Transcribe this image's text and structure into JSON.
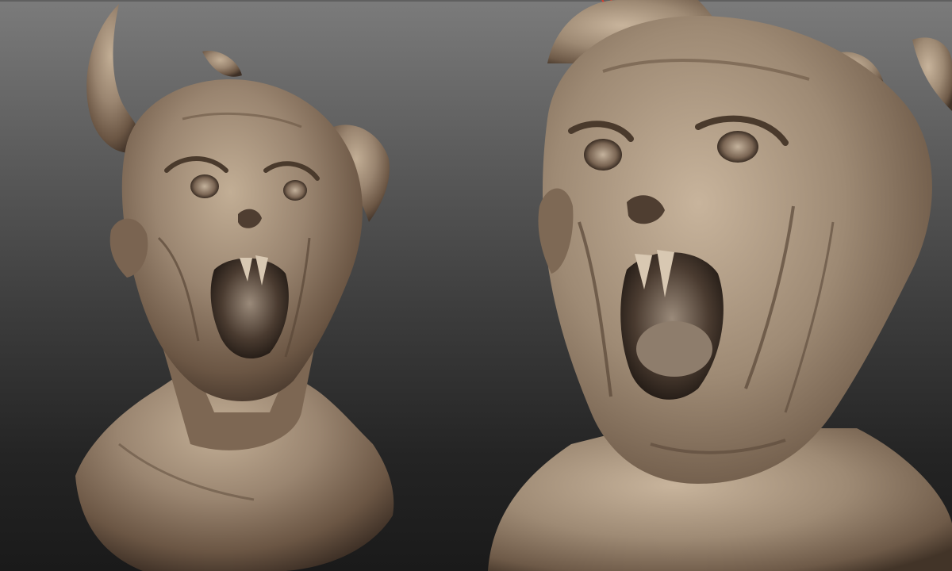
{
  "viewport": {
    "background_top": "#7b7b7b",
    "background_bottom": "#1a1a1a",
    "clay_color": "#8f7a64",
    "clay_light": "#b8a48c",
    "clay_dark": "#4a3a2c",
    "marker_color": "#d93a2a"
  },
  "models": [
    {
      "name": "creature-bust-three-quarter-view",
      "icon": "sculpt-bust"
    },
    {
      "name": "creature-bust-front-close-up",
      "icon": "sculpt-bust"
    }
  ]
}
